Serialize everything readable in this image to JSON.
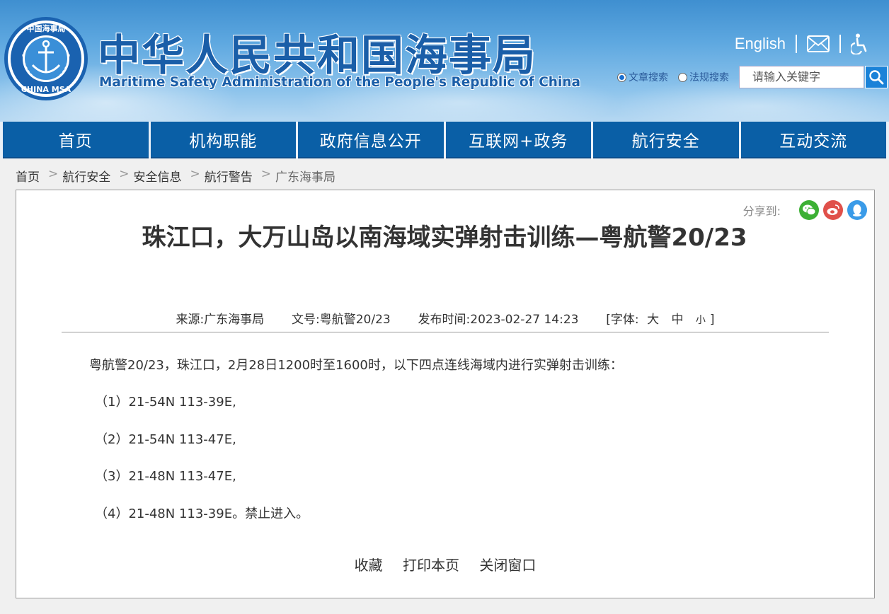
{
  "header": {
    "site_title_cn": "中华人民共和国海事局",
    "site_title_en": "Maritime Safety Administration of the People's Republic of China",
    "logo_text_top": "中国海事局",
    "logo_text_bottom": "CHINA MSA",
    "english_link": "English",
    "mail_icon": "mail-icon",
    "accessibility_icon": "accessibility-icon",
    "search_options": [
      {
        "label": "文章搜索",
        "checked": true
      },
      {
        "label": "法规搜索",
        "checked": false
      }
    ],
    "search_placeholder": "请输入关键字",
    "search_icon": "search-icon"
  },
  "nav": {
    "items": [
      "首页",
      "机构职能",
      "政府信息公开",
      "互联网+政务",
      "航行安全",
      "互动交流"
    ]
  },
  "breadcrumb": {
    "items": [
      "首页",
      "航行安全",
      "安全信息",
      "航行警告",
      "广东海事局"
    ],
    "separator": ">"
  },
  "share": {
    "label": "分享到:",
    "icons": [
      "wechat-icon",
      "weibo-icon",
      "qq-icon"
    ]
  },
  "article": {
    "title": "珠江口，大万山岛以南海域实弹射击训练—粤航警20/23",
    "source_label": "来源:",
    "source": "广东海事局",
    "docno_label": "文号:",
    "docno": "粤航警20/23",
    "time_label": "发布时间:",
    "time": "2023-02-27 14:23",
    "font_label": "[字体:",
    "font_large": "大",
    "font_medium": "中",
    "font_small": "小",
    "font_close": "]",
    "paragraphs": [
      "粤航警20/23，珠江口，2月28日1200时至1600时，以下四点连线海域内进行实弹射击训练：",
      "（1）21-54N 113-39E,",
      "（2）21-54N 113-47E,",
      "（3）21-48N 113-47E,",
      "（4）21-48N 113-39E。禁止进入。"
    ]
  },
  "tools": {
    "favorite": "收藏",
    "print": "打印本页",
    "close": "关闭窗口"
  },
  "colors": {
    "brand_blue": "#0a5fa6",
    "title_blue": "#1a5ea8",
    "wechat": "#3cb034",
    "weibo": "#e0504a",
    "qq": "#3a9be8"
  }
}
